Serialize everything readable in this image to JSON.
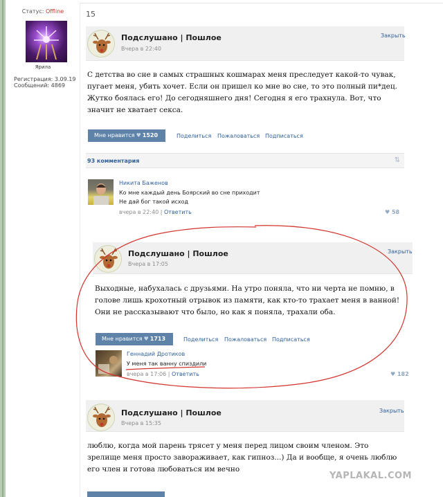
{
  "user_panel": {
    "status_label": "Статус:",
    "status_value": "Offline",
    "username": "Ярила",
    "registration": "Регистрация: 3.09.19",
    "messages": "Сообщений: 4869"
  },
  "post_number": "15",
  "posts": [
    {
      "group": "Подслушано | Пошлое",
      "time": "Вчера в 22:40",
      "close": "Закрыть",
      "text": "С детства во сне в самых страшных кошмарах меня преследует какой-то чувак, пугает меня, убить хочет. Если он пришел ко мне во сне, то это полный пи*дец. Жутко боялась его! До сегодняшнего дня! Сегодня я его трахнула. Вот, что значит не хватает секса.",
      "like_label": "Мне нравится",
      "like_count": "1520",
      "share": "Поделиться",
      "report": "Пожаловаться",
      "subscribe": "Подписаться",
      "comments_count": "93 комментария",
      "comment": {
        "author": "Никита Баженов",
        "line1": "Ко мне каждый день Боярский во сне приходит",
        "line2": "Не дай бог такой исход",
        "time": "вчера в 22:40",
        "reply": "Ответить",
        "likes": "58"
      }
    },
    {
      "group": "Подслушано | Пошлое",
      "time": "Вчера в 17:05",
      "close": "Закрыть",
      "text": "Выходные, набухалась с друзьями. На утро поняла, что ни черта не помню, в голове лишь крохотный отрывок из памяти, как кто-то трахает меня в ванной! Они не рассказывают что было, но как я поняла, трахали оба.",
      "like_label": "Мне нравится",
      "like_count": "1713",
      "share": "Поделиться",
      "report": "Пожаловаться",
      "subscribe": "Подписаться",
      "comment": {
        "author": "Геннадий Дротиков",
        "line1": "У меня так ванну спиздили",
        "time": "вчера в 17:06",
        "reply": "Ответить",
        "likes": "182"
      }
    },
    {
      "group": "Подслушано | Пошлое",
      "time": "Вчера в 15:35",
      "close": "Закрыть",
      "text": "люблю, когда мой парень трясет у меня перед лицом своим членом. Это зрелище меня просто завораживает, как гипноз...) Да и вообще, я очень люблю его член и готова любоваться им вечно"
    }
  ],
  "watermark": "YAPLAKAL.COM",
  "colors": {
    "link": "#2f5f9b",
    "like_button": "#5e82a8",
    "annotation": "#d2332c"
  }
}
